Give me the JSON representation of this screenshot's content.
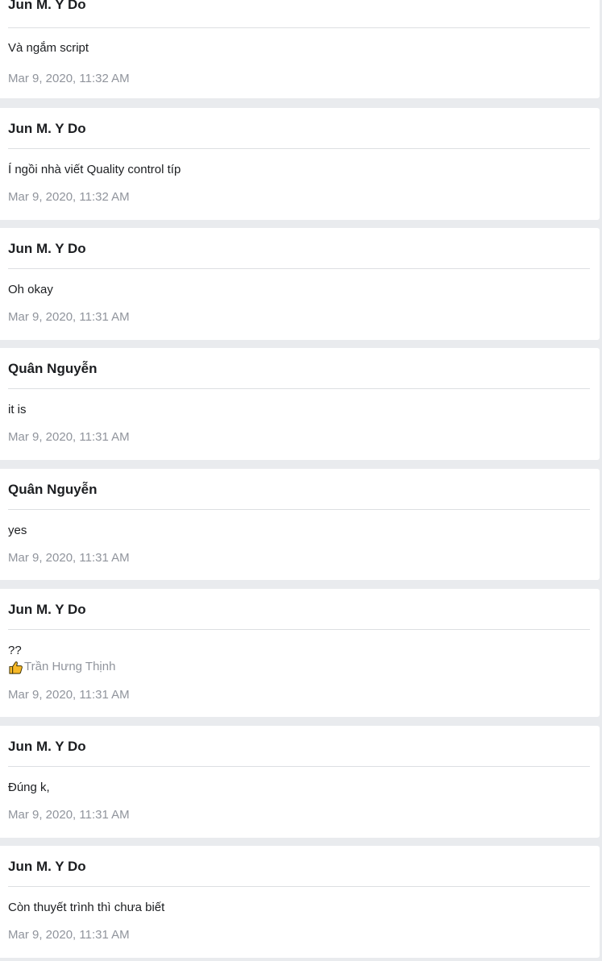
{
  "messages": [
    {
      "sender": "Jun M. Y Do",
      "text": "Và ngắm script",
      "timestamp": "Mar 9, 2020, 11:32 AM"
    },
    {
      "sender": "Jun M. Y Do",
      "text": "Í ngồi nhà viết Quality control típ",
      "timestamp": "Mar 9, 2020, 11:32 AM"
    },
    {
      "sender": "Jun M. Y Do",
      "text": "Oh okay",
      "timestamp": "Mar 9, 2020, 11:31 AM"
    },
    {
      "sender": "Quân Nguyễn",
      "text": "it is",
      "timestamp": "Mar 9, 2020, 11:31 AM"
    },
    {
      "sender": "Quân Nguyễn",
      "text": "yes",
      "timestamp": "Mar 9, 2020, 11:31 AM"
    },
    {
      "sender": "Jun M. Y Do",
      "text": "??",
      "reaction": {
        "icon": "thumbs-up-icon",
        "user": "Trần Hưng Thịnh"
      },
      "timestamp": "Mar 9, 2020, 11:31 AM"
    },
    {
      "sender": "Jun M. Y Do",
      "text": "Đúng k,",
      "timestamp": "Mar 9, 2020, 11:31 AM"
    },
    {
      "sender": "Jun M. Y Do",
      "text": "Còn thuyết trình thì chưa biết",
      "timestamp": "Mar 9, 2020, 11:31 AM"
    }
  ],
  "colors": {
    "page_background": "#e9ebee",
    "card_background": "#ffffff",
    "sender_text": "#1c1e21",
    "timestamp_text": "#90949c",
    "reaction_icon": "#f7b928"
  }
}
